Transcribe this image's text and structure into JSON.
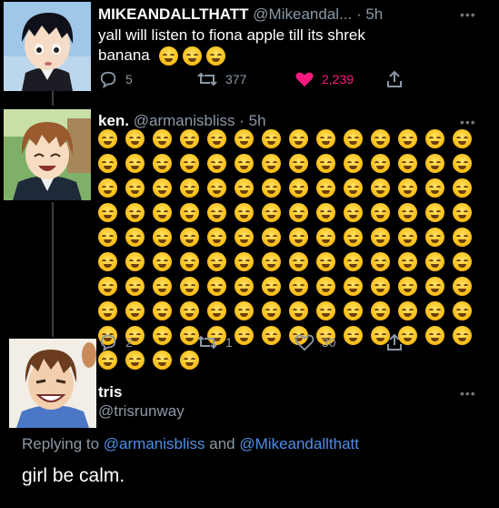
{
  "tweets": [
    {
      "name": "MIKEANDALLTHATT",
      "handle": "@Mikeandal...",
      "time": "· 5h",
      "text_line1": "yall will listen to fiona apple till its shrek",
      "text_line2": "banana",
      "emoji_count": 3,
      "replies": "5",
      "retweets": "377",
      "likes": "2,239",
      "liked": true,
      "like_color": "#f91880"
    },
    {
      "name": "ken.",
      "handle": "@armanisbliss",
      "time": "· 5h",
      "emoji_count": 130,
      "replies": "2",
      "retweets": "1",
      "likes": "30",
      "liked": false
    }
  ],
  "reply": {
    "name": "tris",
    "handle": "@trisrunway",
    "replying_prefix": "Replying to",
    "replying_to_1": "@armanisbliss",
    "replying_and": "and",
    "replying_to_2": "@Mikeandallthatt",
    "text": "girl be calm."
  },
  "icons": {
    "more": "more-dots-icon",
    "reply": "reply-bubble-icon",
    "retweet": "retweet-icon",
    "like": "heart-icon",
    "share": "share-icon"
  },
  "colors": {
    "muted": "#8b98a5",
    "link": "#4f8ee8",
    "like": "#f91880"
  },
  "more_glyph": "•••"
}
